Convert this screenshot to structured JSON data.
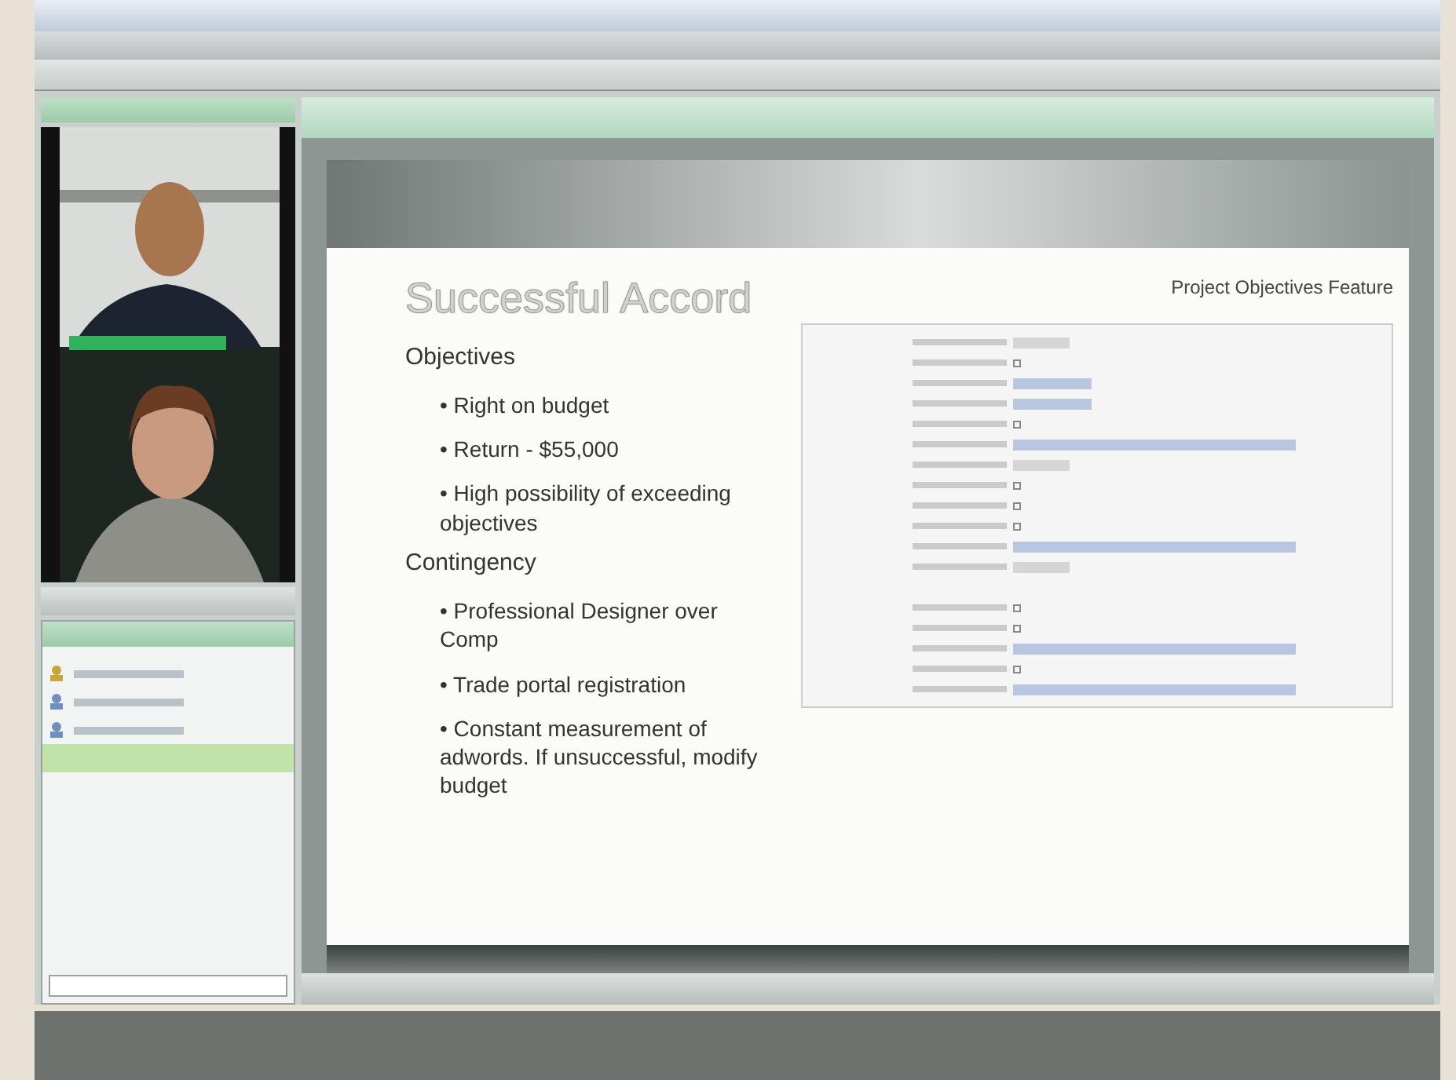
{
  "slide": {
    "title": "Successful Accord",
    "subtitle": "Project Objectives Feature",
    "sections": [
      {
        "heading": "Objectives",
        "bullets": [
          "• Right on budget",
          "• Return - $55,000",
          "• High possibility of exceeding objectives"
        ]
      },
      {
        "heading": "Contingency",
        "bullets": [
          "• Professional Designer over Comp",
          "• Trade portal registration",
          "• Constant measurement of adwords. If unsuccessful, modify budget"
        ]
      }
    ],
    "form_rows": [
      {
        "kind": "button"
      },
      {
        "kind": "check"
      },
      {
        "kind": "short"
      },
      {
        "kind": "short"
      },
      {
        "kind": "check"
      },
      {
        "kind": "long"
      },
      {
        "kind": "button"
      },
      {
        "kind": "check"
      },
      {
        "kind": "check"
      },
      {
        "kind": "check"
      },
      {
        "kind": "long"
      },
      {
        "kind": "button"
      },
      {
        "kind": "gap"
      },
      {
        "kind": "check"
      },
      {
        "kind": "check"
      },
      {
        "kind": "long"
      },
      {
        "kind": "check"
      },
      {
        "kind": "long"
      }
    ]
  },
  "participants": [
    {
      "kind": "host",
      "selected": false
    },
    {
      "kind": "guest",
      "selected": false
    },
    {
      "kind": "guest",
      "selected": false
    },
    {
      "kind": "blank",
      "selected": true
    }
  ]
}
